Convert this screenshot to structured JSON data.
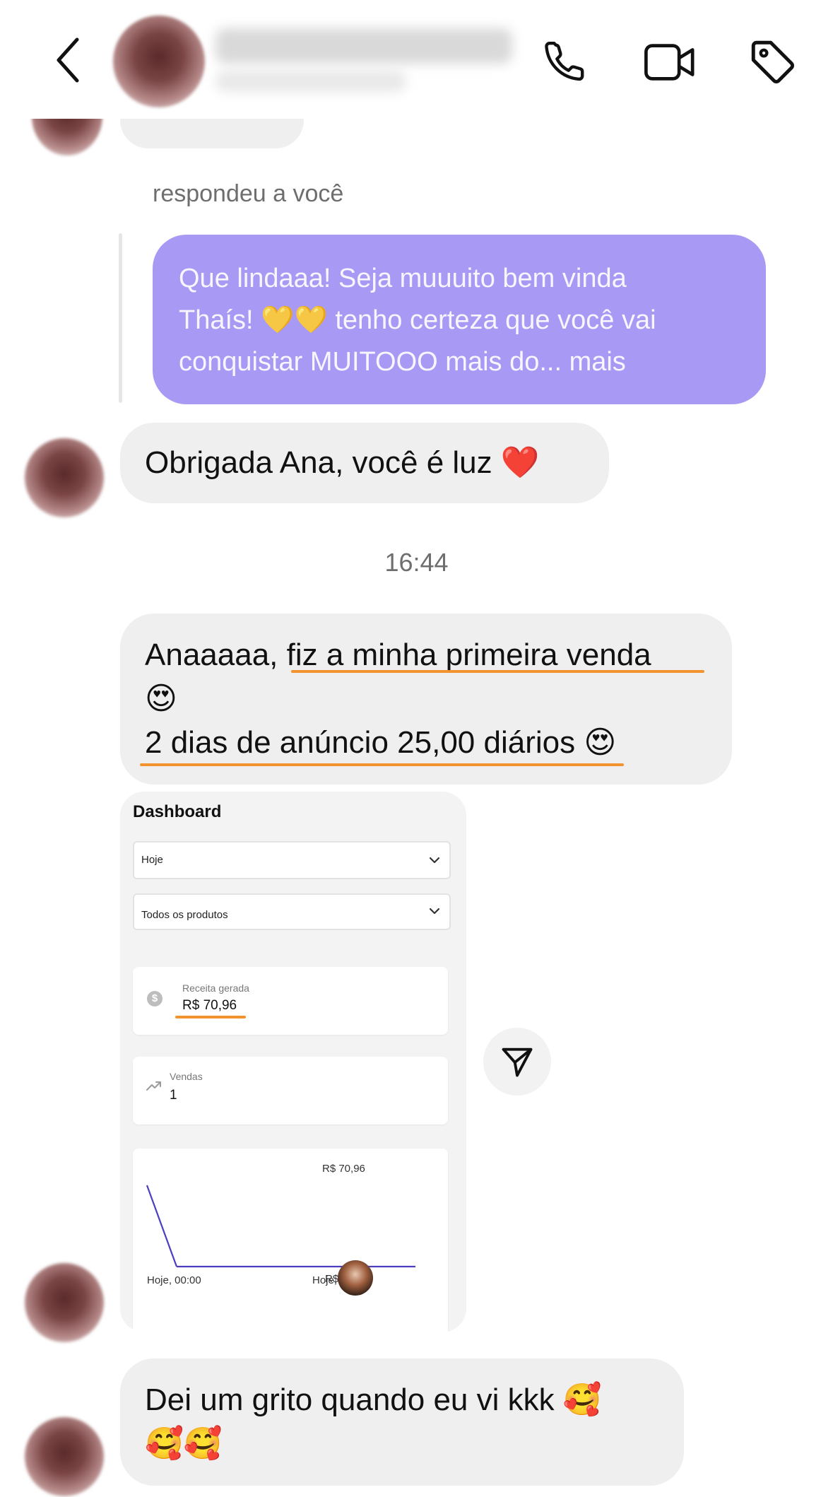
{
  "header": {
    "back_icon": "chevron-left-icon",
    "call_icon": "phone-icon",
    "video_icon": "video-camera-icon",
    "tag_icon": "tag-icon"
  },
  "thread": {
    "reply_context": "respondeu a você",
    "quoted_message_lines": [
      "Que lindaaa! Seja muuuito bem vinda",
      "Thaís! 💛💛 tenho certeza que você vai",
      "conquistar MUITOOO mais do... mais"
    ],
    "message_1": "Obrigada Ana, você é luz ❤️",
    "timestamp": "16:44",
    "message_2_line1": "Anaaaaa, fiz a minha primeira venda",
    "message_2_line2": "😍",
    "message_2_line3": "2 dias de anúncio 25,00 diários 😍",
    "message_3_line1": "Dei um grito quando eu vi kkk 🥰",
    "message_3_line2": "🥰🥰"
  },
  "dashboard": {
    "title": "Dashboard",
    "period_select": "Hoje",
    "product_select": "Todos os produtos",
    "revenue_label": "Receita gerada",
    "revenue_value": "R$ 70,96",
    "sales_label": "Vendas",
    "sales_value": "1",
    "chart_top_label": "R$ 70,96",
    "chart_bottom_label": "R$ 0,00",
    "x_start": "Hoje, 00:00",
    "x_end": "Hoje, 2",
    "line_color": "#4b3fbf"
  },
  "chart_data": {
    "type": "line",
    "x": [
      "Hoje, 00:00",
      "",
      "Hoje, 2"
    ],
    "series": [
      {
        "values": [
          70.96,
          0,
          0
        ]
      }
    ],
    "ylim": [
      0,
      70.96
    ]
  },
  "share_icon": "send-icon"
}
